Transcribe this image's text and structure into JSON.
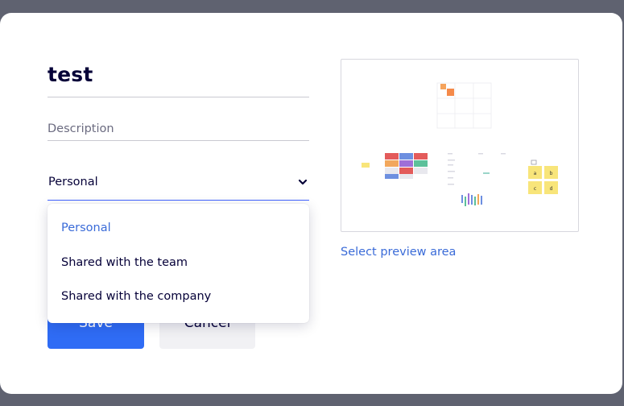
{
  "form": {
    "title": "test",
    "description_placeholder": "Description",
    "sharing_selected": "Personal",
    "sharing_options": [
      "Personal",
      "Shared with the team",
      "Shared with the company"
    ],
    "save_label": "Save",
    "cancel_label": "Cancel"
  },
  "preview": {
    "select_area_label": "Select preview area",
    "sticky_labels": [
      "a",
      "b",
      "c",
      "d"
    ]
  },
  "colors": {
    "primary": "#2f6cf5",
    "link": "#3a6bd8",
    "text": "#050038",
    "backdrop": "#5f6270"
  }
}
